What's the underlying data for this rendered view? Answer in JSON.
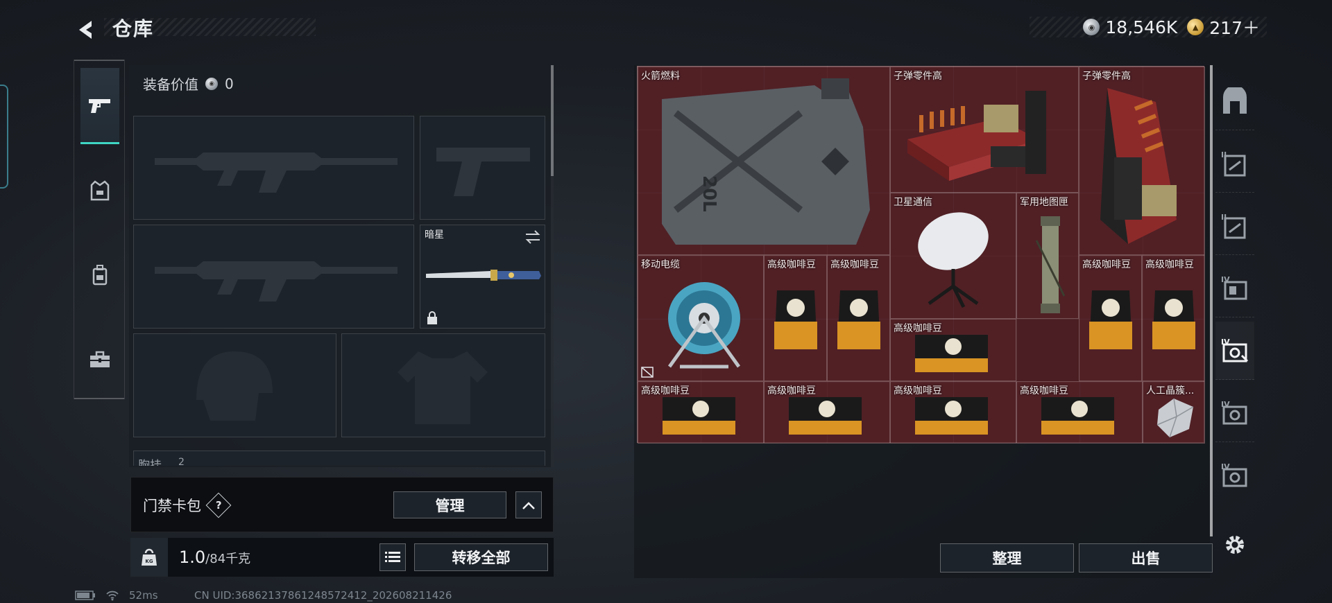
{
  "header": {
    "title": "仓库"
  },
  "currency": {
    "silver": "18,546K",
    "gold": "217＋"
  },
  "equipment": {
    "value_label": "装备价值",
    "value": "0",
    "melee_name": "暗星",
    "chest_rig_label": "胸挂",
    "chest_rig_count": "2"
  },
  "keycard": {
    "title": "门禁卡包",
    "help": "?",
    "manage": "管理"
  },
  "weight": {
    "current": "1.0",
    "max": "/84千克",
    "transfer_all": "转移全部"
  },
  "storage": {
    "items": [
      {
        "name": "火箭燃料"
      },
      {
        "name": "子弹零件高"
      },
      {
        "name": "子弹零件高"
      },
      {
        "name": "卫星通信"
      },
      {
        "name": "军用地图匣"
      },
      {
        "name": "移动电缆"
      },
      {
        "name": "高级咖啡豆"
      },
      {
        "name": "高级咖啡豆"
      },
      {
        "name": "高级咖啡豆"
      },
      {
        "name": "高级咖啡豆"
      },
      {
        "name": "高级咖啡豆"
      },
      {
        "name": "高级咖啡豆"
      },
      {
        "name": "高级咖啡豆"
      },
      {
        "name": "高级咖啡豆"
      },
      {
        "name": "高级咖啡豆"
      },
      {
        "name": "人工晶簇..."
      }
    ],
    "sort": "整理",
    "sell": "出售"
  },
  "stash_tabs": [
    "",
    "II",
    "II",
    "IV",
    "IV",
    "IV",
    "IV"
  ],
  "status": {
    "ping": "52ms",
    "uid": "CN UID:3686213786124857241​2_202608211426"
  },
  "colors": {
    "accent": "#3fd6c4",
    "grid_bg": "#4a1e22"
  }
}
